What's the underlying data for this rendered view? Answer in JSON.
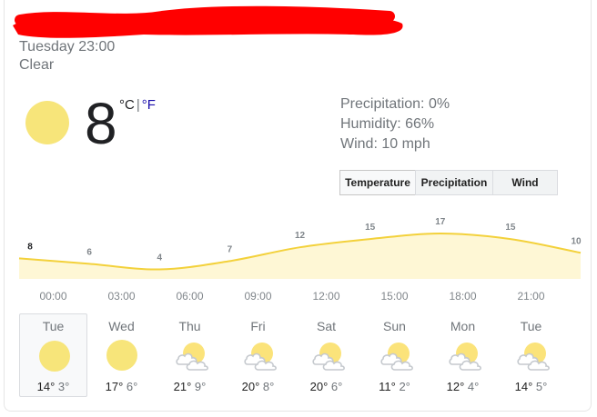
{
  "header": {
    "datetime": "Tuesday 23:00",
    "condition": "Clear"
  },
  "current": {
    "temperature": "8",
    "unit_c": "°C",
    "separator": "|",
    "unit_f": "°F",
    "icon": "sun-icon",
    "precipitation": "Precipitation: 0%",
    "humidity": "Humidity: 66%",
    "wind": "Wind: 10 mph"
  },
  "tabs": [
    {
      "label": "Temperature",
      "selected": true
    },
    {
      "label": "Precipitation",
      "selected": false
    },
    {
      "label": "Wind",
      "selected": false
    }
  ],
  "chart_data": {
    "type": "area",
    "x": [
      "00:00",
      "03:00",
      "06:00",
      "09:00",
      "12:00",
      "15:00",
      "18:00",
      "21:00"
    ],
    "labels": [
      "8",
      "6",
      "4",
      "7",
      "12",
      "15",
      "17",
      "15",
      "10"
    ],
    "values": [
      8,
      6,
      4,
      7,
      12,
      15,
      17,
      15,
      10
    ],
    "line_color": "#f3d13b",
    "fill_color": "#fef7d5",
    "label_color": "#80868b",
    "current_label_color": "#202124"
  },
  "forecast": [
    {
      "day": "Tue",
      "high": "14°",
      "low": "3°",
      "icon": "sun-icon",
      "selected": true
    },
    {
      "day": "Wed",
      "high": "17°",
      "low": "6°",
      "icon": "sun-icon"
    },
    {
      "day": "Thu",
      "high": "21°",
      "low": "9°",
      "icon": "partly-cloudy-icon"
    },
    {
      "day": "Fri",
      "high": "20°",
      "low": "8°",
      "icon": "partly-cloudy-icon"
    },
    {
      "day": "Sat",
      "high": "20°",
      "low": "6°",
      "icon": "partly-cloudy-icon"
    },
    {
      "day": "Sun",
      "high": "11°",
      "low": "2°",
      "icon": "partly-cloudy-icon"
    },
    {
      "day": "Mon",
      "high": "12°",
      "low": "4°",
      "icon": "partly-cloudy-icon"
    },
    {
      "day": "Tue",
      "high": "14°",
      "low": "5°",
      "icon": "partly-cloudy-icon"
    }
  ],
  "colors": {
    "sun": "#f7e57a",
    "sun_partial": "#fbe37a",
    "cloud": "#c5c9ce",
    "redaction": "#ff0000"
  }
}
